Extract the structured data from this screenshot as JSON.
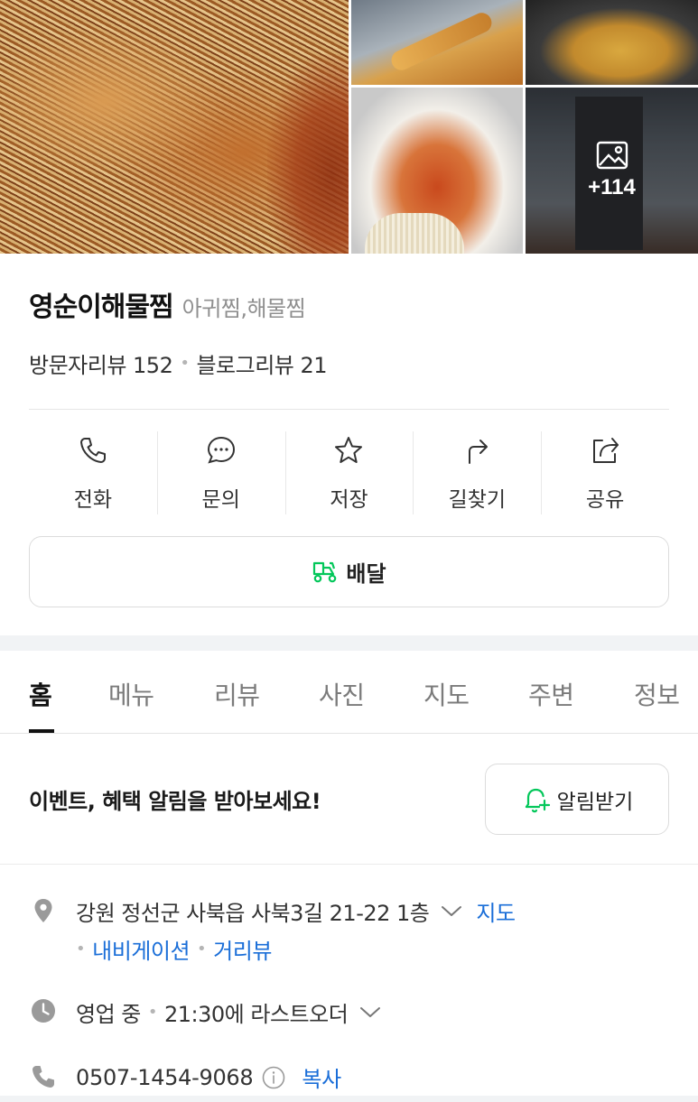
{
  "gallery": {
    "more_count": "+114",
    "photos": [
      "food-photo-main",
      "food-photo-fried",
      "food-photo-pan",
      "food-photo-plate",
      "storefront-photo"
    ]
  },
  "place": {
    "name": "영순이해물찜",
    "category": "아귀찜,해물찜",
    "visitor_reviews": "방문자리뷰 152",
    "blog_reviews": "블로그리뷰 21",
    "separator": "•"
  },
  "actions": [
    {
      "label": "전화",
      "icon": "phone-icon"
    },
    {
      "label": "문의",
      "icon": "chat-icon"
    },
    {
      "label": "저장",
      "icon": "star-icon"
    },
    {
      "label": "길찾기",
      "icon": "directions-icon"
    },
    {
      "label": "공유",
      "icon": "share-icon"
    }
  ],
  "delivery": {
    "label": "배달",
    "icon": "delivery-scooter-icon",
    "icon_color": "#03c75a"
  },
  "tabs": [
    {
      "label": "홈",
      "active": true
    },
    {
      "label": "메뉴"
    },
    {
      "label": "리뷰"
    },
    {
      "label": "사진"
    },
    {
      "label": "지도"
    },
    {
      "label": "주변"
    },
    {
      "label": "정보"
    }
  ],
  "alert": {
    "text": "이벤트, 혜택 알림을 받아보세요!",
    "button_label": "알림받기",
    "button_icon": "bell-plus-icon"
  },
  "info": {
    "address": "강원 정선군 사북읍 사북3길 21-22 1층",
    "map_link": "지도",
    "navigation_link": "내비게이션",
    "street_view_link": "거리뷰",
    "status": "영업 중",
    "last_order": "21:30에 라스트오더",
    "phone": "0507-1454-9068",
    "copy_label": "복사"
  },
  "colors": {
    "link": "#1a6ed8",
    "accent_green": "#03c75a",
    "muted_text": "#8f8f8f",
    "icon_gray": "#9a9a9a"
  }
}
